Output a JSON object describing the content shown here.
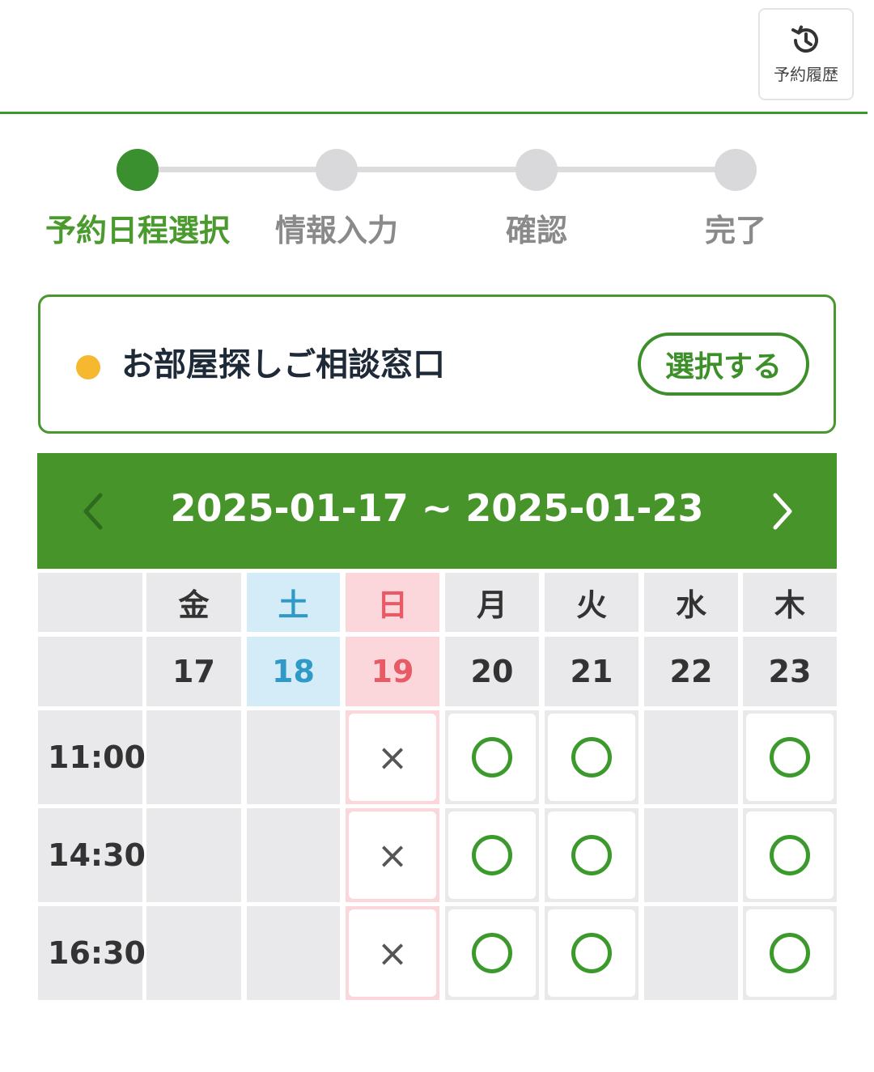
{
  "header": {
    "history_label": "予約履歴",
    "history_icon": "history-icon"
  },
  "steps": [
    {
      "label": "予約日程選択",
      "active": true
    },
    {
      "label": "情報入力",
      "active": false
    },
    {
      "label": "確認",
      "active": false
    },
    {
      "label": "完了",
      "active": false
    }
  ],
  "consult": {
    "title": "お部屋探しご相談窓口",
    "select_label": "選択する"
  },
  "calendar": {
    "range": "2025-01-17 ~ 2025-01-23",
    "prev_icon": "chevron-left-icon",
    "next_icon": "chevron-right-icon",
    "days": [
      {
        "weekday": "金",
        "date": "17",
        "type": "weekday"
      },
      {
        "weekday": "土",
        "date": "18",
        "type": "sat"
      },
      {
        "weekday": "日",
        "date": "19",
        "type": "sun"
      },
      {
        "weekday": "月",
        "date": "20",
        "type": "weekday"
      },
      {
        "weekday": "火",
        "date": "21",
        "type": "weekday"
      },
      {
        "weekday": "水",
        "date": "22",
        "type": "weekday"
      },
      {
        "weekday": "木",
        "date": "23",
        "type": "weekday"
      }
    ],
    "slots": [
      {
        "time": "11:00",
        "status": [
          "none",
          "none",
          "closed",
          "available",
          "available",
          "none",
          "available"
        ]
      },
      {
        "time": "14:30",
        "status": [
          "none",
          "none",
          "closed",
          "available",
          "available",
          "none",
          "available"
        ]
      },
      {
        "time": "16:30",
        "status": [
          "none",
          "none",
          "closed",
          "available",
          "available",
          "none",
          "available"
        ]
      }
    ],
    "closed_symbol": "×",
    "colors": {
      "accent": "#47942b",
      "saturday": "#2f99c8",
      "sunday": "#e75a66",
      "dot": "#f5b82e"
    }
  }
}
